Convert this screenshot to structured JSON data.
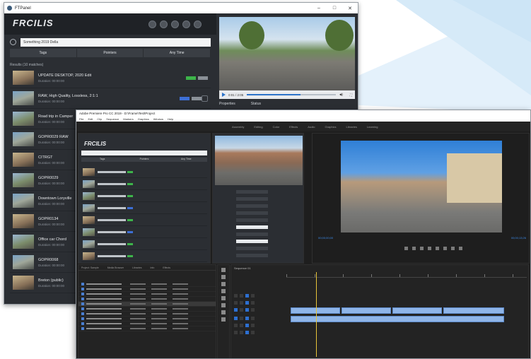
{
  "colors": {
    "accent_blue": "#2c73c9",
    "badge_green": "#3db44a",
    "badge_blue": "#3d6fd6",
    "panel_dark": "#2b2e33",
    "premiere_bg": "#1e1e1e"
  },
  "ftpanel": {
    "title": "FTPanel",
    "logo": "FRCILIS",
    "search_value": "Something 2019 Della",
    "filters": [
      "Tags",
      "Pointers",
      "Any Time"
    ],
    "results_heading": "Results (10 matches)",
    "results": [
      {
        "title": "UPDATE DESKTOP, 2020 Edit",
        "sub": "Duration: 00:00:00"
      },
      {
        "title": "RAW, High Quality, Lossless, 2:1:1",
        "sub": "Duration: 00:00:00"
      },
      {
        "title": "Road trip in Camper",
        "sub": "Duration: 00:00:00"
      },
      {
        "title": "GOPR0029 RAW",
        "sub": "Duration: 00:00:00"
      },
      {
        "title": "CITRGT",
        "sub": "Duration: 00:00:00"
      },
      {
        "title": "GOPR0029",
        "sub": "Duration: 00:00:00"
      },
      {
        "title": "Downtown Loryville",
        "sub": "Duration: 00:00:00"
      },
      {
        "title": "GOPR0134",
        "sub": "Duration: 00:00:00"
      },
      {
        "title": "Office car Chord",
        "sub": "Duration: 00:00:00"
      },
      {
        "title": "GOPR0068",
        "sub": "Duration: 00:00:00"
      },
      {
        "title": "Breton (public)",
        "sub": "Duration: 00:00:00"
      }
    ],
    "player_time": "0:01 / 2:05",
    "progress": 0.6,
    "meta_tabs": [
      "Properties",
      "Status"
    ]
  },
  "premiere": {
    "title": "Adobe Premiere Pro CC 2019 - D:\\Frame\\Test\\Project",
    "menu": [
      "File",
      "Edit",
      "Clip",
      "Sequence",
      "Markers",
      "Graphics",
      "Window",
      "Help"
    ],
    "workspaces": [
      "Assembly",
      "Editing",
      "Color",
      "Effects",
      "Audio",
      "Graphics",
      "Libraries",
      "Learning"
    ],
    "ext_logo": "FRCILIS",
    "ext_filters": [
      "Tags",
      "Pointers",
      "Any Time"
    ],
    "project_tabs": [
      "Project: Sample",
      "Media Browser",
      "Libraries",
      "Info",
      "Effects"
    ],
    "timecode_left": "00;00;00;00",
    "timecode_right": "00;00;13;26",
    "timeline_tab": "Sequence 01"
  }
}
